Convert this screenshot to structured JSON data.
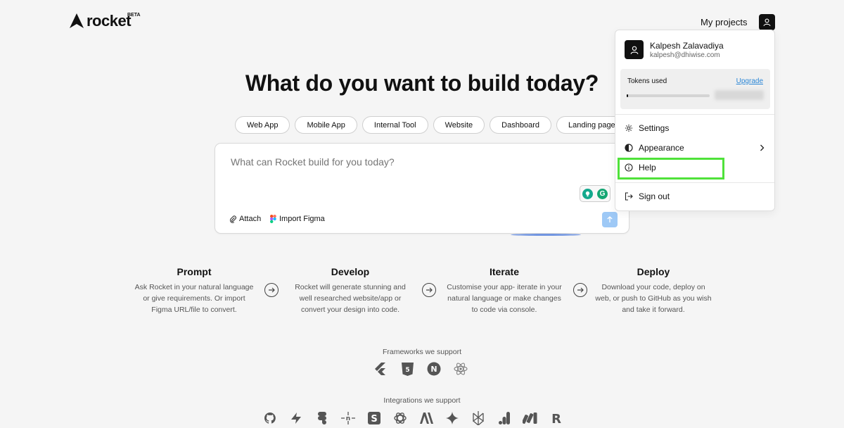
{
  "header": {
    "logo_text": "rocket",
    "logo_badge": "BETA",
    "my_projects": "My projects"
  },
  "hero": {
    "title": "What do you want to build today?"
  },
  "chips": [
    "Web App",
    "Mobile App",
    "Internal Tool",
    "Website",
    "Dashboard",
    "Landing page"
  ],
  "prompt": {
    "placeholder": "What can Rocket build for you today?",
    "attach_label": "Attach",
    "import_figma_label": "Import Figma"
  },
  "steps": [
    {
      "title": "Prompt",
      "desc": "Ask Rocket in your natural language or give requirements. Or import Figma URL/file to convert."
    },
    {
      "title": "Develop",
      "desc": "Rocket will generate stunning and well researched website/app or convert your design into code."
    },
    {
      "title": "Iterate",
      "desc": "Customise your app- iterate in your natural language or make changes to code via console."
    },
    {
      "title": "Deploy",
      "desc": "Download your code, deploy on web, or push to GitHub as you wish and take it forward."
    }
  ],
  "frameworks": {
    "label": "Frameworks we support",
    "icons": [
      "flutter-icon",
      "html5-icon",
      "nextjs-icon",
      "react-icon"
    ]
  },
  "integrations": {
    "label": "Integrations we support",
    "icons": [
      "github-icon",
      "supabase-icon",
      "figma-icon",
      "netlify-icon",
      "stripe-icon",
      "openai-icon",
      "anthropic-icon",
      "gemini-icon",
      "perplexity-icon",
      "analytics-icon",
      "make-icon",
      "resend-icon"
    ]
  },
  "account_menu": {
    "name": "Kalpesh Zalavadiya",
    "email": "kalpesh@dhiwise.com",
    "tokens_label": "Tokens used",
    "upgrade_label": "Upgrade",
    "tokens_progress": 0.02,
    "items": {
      "settings": "Settings",
      "appearance": "Appearance",
      "help": "Help",
      "sign_out": "Sign out"
    }
  },
  "colors": {
    "accent_link": "#2a86d6",
    "highlight": "#4fe23a",
    "send_button": "#9ec9f6"
  }
}
